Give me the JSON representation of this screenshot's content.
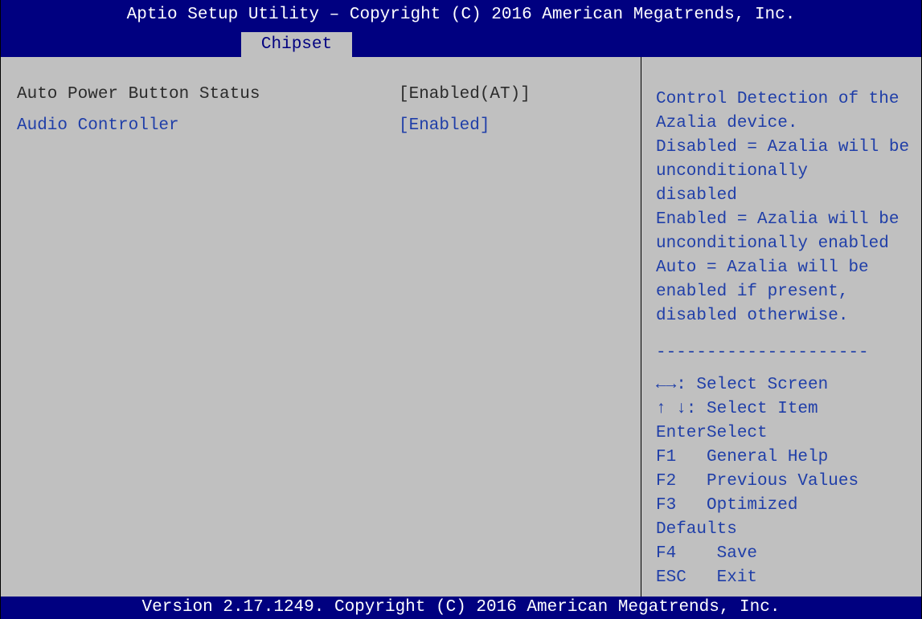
{
  "header": {
    "title": "Aptio Setup Utility – Copyright (C) 2016 American Megatrends, Inc.",
    "tabs": [
      {
        "label": "Chipset",
        "active": true
      }
    ]
  },
  "settings": [
    {
      "label": "Auto Power Button Status",
      "value": "[Enabled(AT)]",
      "selected": false
    },
    {
      "label": "Audio Controller",
      "value": "[Enabled]",
      "selected": true
    }
  ],
  "help": {
    "lines": [
      "Control Detection of the",
      "Azalia device.",
      "Disabled = Azalia will be",
      "unconditionally",
      "disabled",
      "Enabled = Azalia will be",
      "unconditionally enabled",
      "Auto = Azalia will be",
      "enabled if present,",
      "disabled otherwise."
    ],
    "separator": "---------------------"
  },
  "keys": [
    "←→: Select Screen",
    "↑ ↓: Select Item",
    "EnterSelect",
    "F1   General Help",
    "F2   Previous Values",
    "F3   Optimized",
    "Defaults",
    "F4    Save",
    "ESC   Exit"
  ],
  "footer": {
    "version": "Version 2.17.1249. Copyright (C) 2016 American Megatrends, Inc."
  },
  "colors": {
    "bar_bg": "#000080",
    "body_bg": "#c0c0c0",
    "highlight_text": "#1f3ea8",
    "normal_text": "#2b2b2b"
  }
}
